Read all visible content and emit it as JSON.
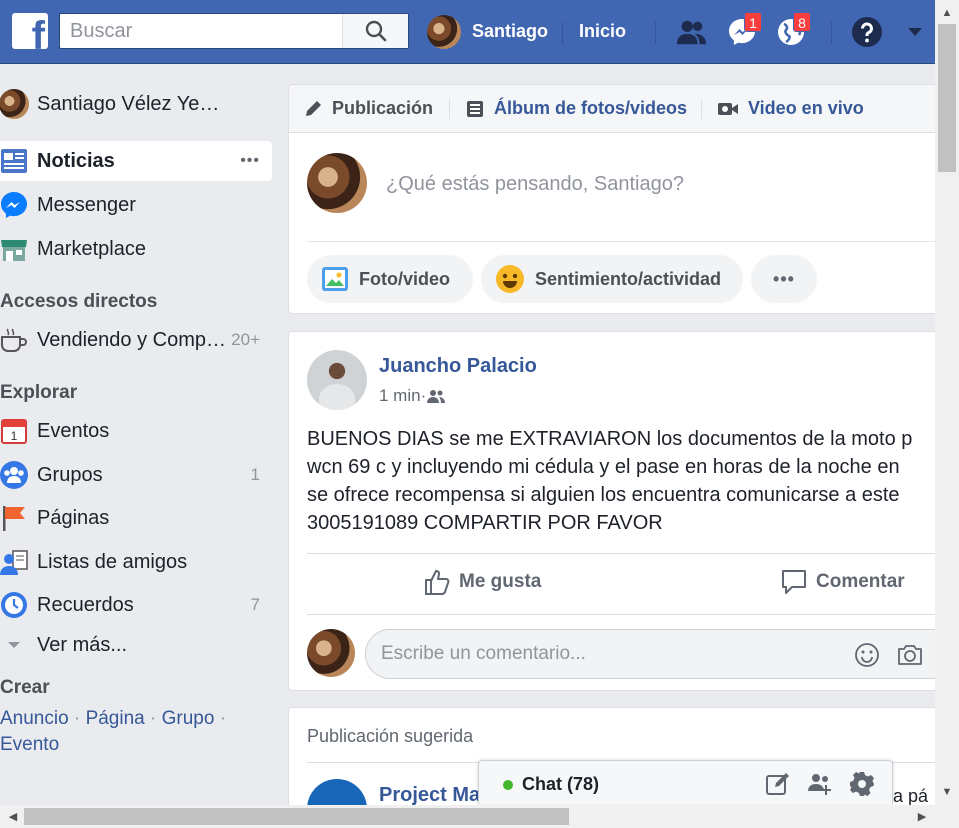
{
  "topbar": {
    "logo": "f",
    "search_placeholder": "Buscar",
    "user_name": "Santiago",
    "home_label": "Inicio",
    "messenger_badge": "1",
    "notifications_badge": "8",
    "icons": [
      "friends-icon",
      "messenger-icon",
      "globe-icon",
      "help-icon",
      "dropdown-arrow-icon"
    ]
  },
  "sidebar": {
    "profile_name": "Santiago Vélez Ye…",
    "items": [
      {
        "label": "Noticias",
        "icon": "news-feed-icon"
      },
      {
        "label": "Messenger",
        "icon": "messenger-icon"
      },
      {
        "label": "Marketplace",
        "icon": "marketplace-icon"
      }
    ],
    "more_dots": "•••",
    "shortcuts_heading": "Accesos directos",
    "shortcuts": [
      {
        "label": "Vendiendo y Comp…",
        "count": "20+"
      }
    ],
    "explore_heading": "Explorar",
    "explore": [
      {
        "label": "Eventos",
        "count": "",
        "icon": "calendar-icon"
      },
      {
        "label": "Grupos",
        "count": "1",
        "icon": "groups-icon"
      },
      {
        "label": "Páginas",
        "count": "",
        "icon": "flag-icon"
      },
      {
        "label": "Listas de amigos",
        "count": "",
        "icon": "friend-list-icon"
      },
      {
        "label": "Recuerdos",
        "count": "7",
        "icon": "memories-icon"
      }
    ],
    "see_more": "Ver más...",
    "create_heading": "Crear",
    "create_links": [
      "Anuncio",
      "Página",
      "Grupo",
      "Evento"
    ],
    "create_sep": " · "
  },
  "composer": {
    "tabs": [
      "Publicación",
      "Álbum de fotos/videos",
      "Video en vivo"
    ],
    "prompt": "¿Qué estás pensando, Santiago?",
    "buttons": [
      "Foto/video",
      "Sentimiento/actividad",
      "•••"
    ]
  },
  "post": {
    "author": "Juancho Palacio",
    "time": "1 min",
    "meta_sep": " · ",
    "text_lines": [
      "BUENOS DIAS se me EXTRAVIARON los documentos de la moto p",
      "wcn 69 c y incluyendo mi cédula y el pase en horas de la noche en",
      "se ofrece recompensa si alguien los encuentra comunicarse a este",
      "3005191089 COMPARTIR POR FAVOR"
    ],
    "like_label": "Me gusta",
    "comment_label": "Comentar",
    "comment_placeholder": "Escribe un comentario..."
  },
  "suggested": {
    "heading": "Publicación sugerida",
    "page_name": "Project Ma",
    "right_text": "sta pá"
  },
  "chat": {
    "label": "Chat (78)"
  },
  "colors": {
    "brand": "#4267b2",
    "link": "#365899",
    "badge": "#fa3e3e",
    "online": "#42b72a"
  }
}
